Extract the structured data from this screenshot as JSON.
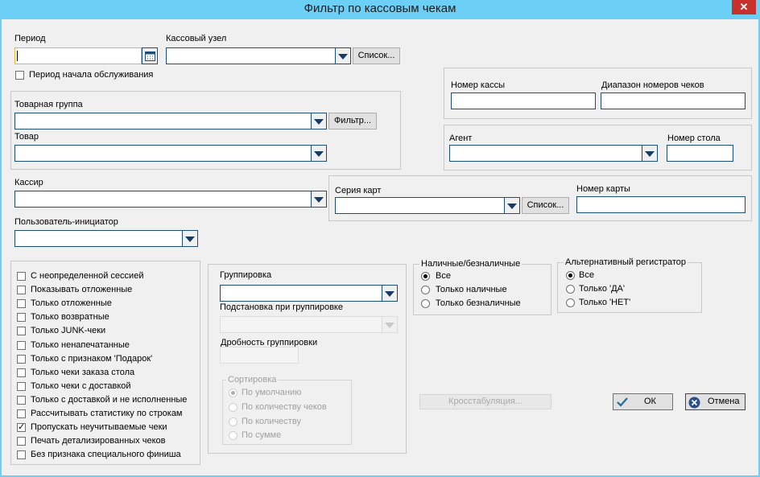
{
  "window": {
    "title": "Фильтр по кассовым чекам",
    "close": "✕"
  },
  "period": {
    "label": "Период",
    "value": "",
    "service_start": "Период начала обслуживания"
  },
  "cash_node": {
    "label": "Кассовый узел",
    "value": "",
    "list_button": "Список..."
  },
  "register_box": {
    "register_label": "Номер кассы",
    "range_label": "Диапазон номеров чеков",
    "register_value": "",
    "range_value": ""
  },
  "product_box": {
    "group_label": "Товарная группа",
    "filter_button": "Фильтр...",
    "product_label": "Товар"
  },
  "agent_box": {
    "agent_label": "Агент",
    "table_label": "Номер стола",
    "table_value": ""
  },
  "cashier": {
    "label": "Кассир"
  },
  "card_box": {
    "series_label": "Серия карт",
    "list_button": "Список...",
    "number_label": "Номер карты",
    "number_value": ""
  },
  "initiator": {
    "label": "Пользователь-инициатор"
  },
  "checkboxes": [
    {
      "label": "С неопределенной сессией",
      "checked": false
    },
    {
      "label": "Показывать отложенные",
      "checked": false
    },
    {
      "label": "Только отложенные",
      "checked": false
    },
    {
      "label": "Только возвратные",
      "checked": false
    },
    {
      "label": "Только JUNK-чеки",
      "checked": false
    },
    {
      "label": "Только ненапечатанные",
      "checked": false
    },
    {
      "label": "Только с признаком 'Подарок'",
      "checked": false
    },
    {
      "label": "Только чеки заказа стола",
      "checked": false
    },
    {
      "label": "Только чеки с доставкой",
      "checked": false
    },
    {
      "label": "Только с доставкой и не исполненные",
      "checked": false
    },
    {
      "label": "Рассчитывать статистику по строкам",
      "checked": false
    },
    {
      "label": "Пропускать неучитываемые чеки",
      "checked": true
    },
    {
      "label": "Печать детализированных чеков",
      "checked": false
    },
    {
      "label": "Без признака специального финиша",
      "checked": false
    }
  ],
  "grouping": {
    "label": "Группировка",
    "substitution_label": "Подстановка при группировке",
    "granularity_label": "Дробность группировки",
    "sort_label": "Сортировка",
    "sort_options": [
      {
        "label": "По умолчанию",
        "selected": true
      },
      {
        "label": "По количеству чеков",
        "selected": false
      },
      {
        "label": "По количеству",
        "selected": false
      },
      {
        "label": "По сумме",
        "selected": false
      }
    ]
  },
  "payment": {
    "label": "Наличные/безналичные",
    "options": [
      {
        "label": "Все",
        "selected": true
      },
      {
        "label": "Только наличные",
        "selected": false
      },
      {
        "label": "Только безналичные",
        "selected": false
      }
    ]
  },
  "alt_registrar": {
    "label": "Альтернативный регистратор",
    "options": [
      {
        "label": "Все",
        "selected": true
      },
      {
        "label": "Только 'ДА'",
        "selected": false
      },
      {
        "label": "Только 'НЕТ'",
        "selected": false
      }
    ]
  },
  "buttons": {
    "crosstab": "Кросстабуляция...",
    "ok": "ОК",
    "cancel": "Отмена"
  },
  "colors": {
    "titlebar": "#6ccff6",
    "close": "#c7302b",
    "input_border": "#1b4f7a",
    "focus_border": "#f0b040"
  }
}
